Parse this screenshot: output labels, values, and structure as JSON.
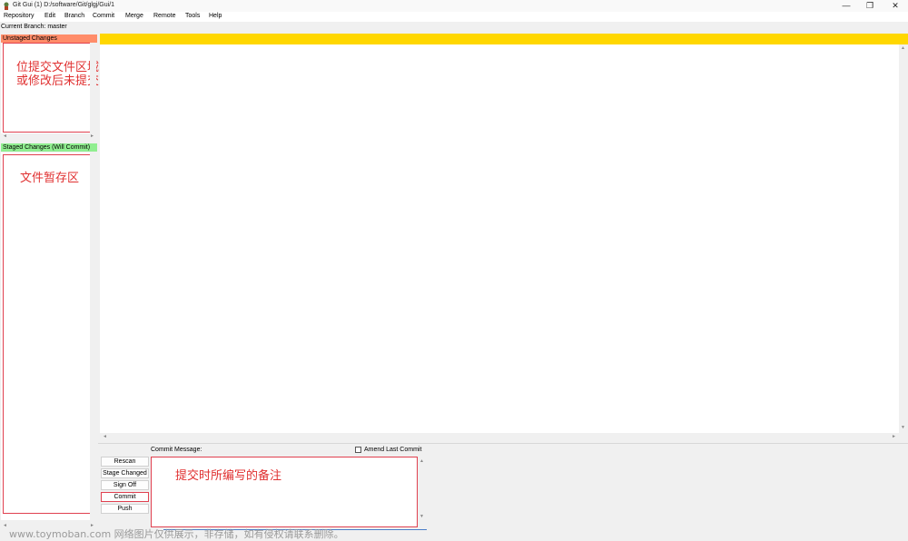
{
  "window": {
    "title": "Git Gui (1) D:/software/Git/glgj/Gui/1",
    "controls": {
      "minimize": "—",
      "restore": "❐",
      "close": "✕"
    }
  },
  "menubar": [
    "Repository",
    "Edit",
    "Branch",
    "Commit",
    "Merge",
    "Remote",
    "Tools",
    "Help"
  ],
  "current_branch": "Current Branch: master",
  "unstaged": {
    "header": "Unstaged Changes",
    "color": "#ff8c69",
    "annotation_line1": "位提交文件区域",
    "annotation_line2": "或修改后未提交的"
  },
  "staged": {
    "header": "Staged Changes (Will Commit)",
    "color": "#90ee90",
    "annotation": "文件暂存区"
  },
  "diff": {
    "header_color": "#ffd700"
  },
  "commit": {
    "label": "Commit Message:",
    "amend_label": "Amend Last Commit",
    "annotation": "提交时所编写的备注",
    "buttons": {
      "rescan": "Rescan",
      "stage_changed": "Stage Changed",
      "sign_off": "Sign Off",
      "commit": "Commit",
      "push": "Push"
    }
  },
  "watermark": "www.toymoban.com 网络图片仅供展示，非存储，如有侵权请联系删除。",
  "accent_red": "#e0404f"
}
